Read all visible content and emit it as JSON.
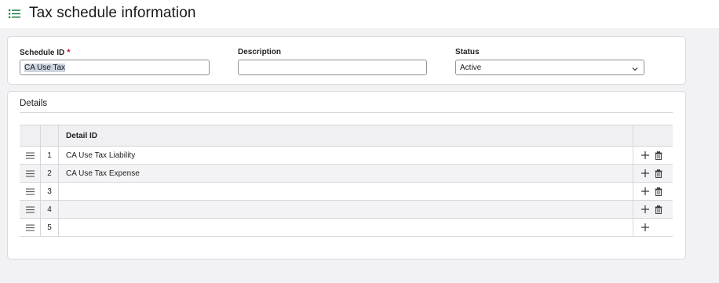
{
  "page": {
    "title": "Tax schedule information"
  },
  "header_form": {
    "schedule_id": {
      "label": "Schedule ID",
      "required_mark": "*",
      "value": "CA Use Tax"
    },
    "description": {
      "label": "Description",
      "value": ""
    },
    "status": {
      "label": "Status",
      "value": "Active"
    }
  },
  "details": {
    "title": "Details",
    "columns": {
      "detail_id": "Detail ID"
    },
    "rows": [
      {
        "num": "1",
        "detail_id": "CA Use Tax Liability"
      },
      {
        "num": "2",
        "detail_id": "CA Use Tax Expense"
      },
      {
        "num": "3",
        "detail_id": ""
      },
      {
        "num": "4",
        "detail_id": ""
      },
      {
        "num": "5",
        "detail_id": ""
      }
    ]
  },
  "colors": {
    "accent": "#1f7a3f",
    "required": "#c8102e"
  }
}
